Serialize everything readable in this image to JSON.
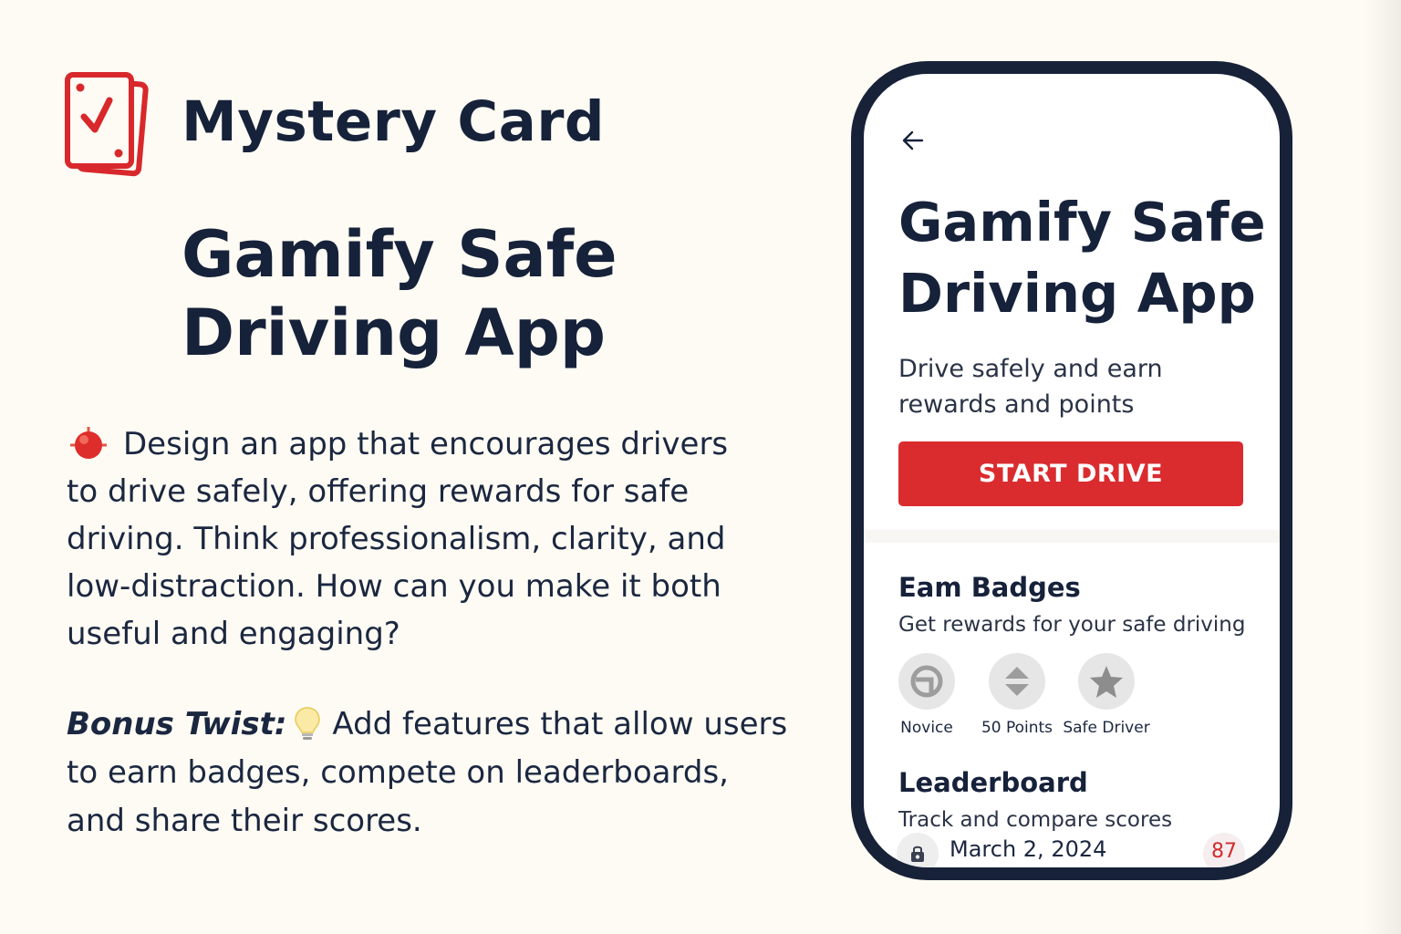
{
  "card": {
    "brand_title": "Mystery Card",
    "title": "Gamify Safe Driving App",
    "prompt": "Design an app that encourages drivers to drive safely, offering rewards for safe driving. Think professionalism, clarity, and low-distraction. How can you make it both useful and engaging?",
    "bonus_label": "Bonus Twist:",
    "bonus_text": "Add features that allow users to earn badges, compete on leaderboards, and share their scores.",
    "icons": [
      "card-check-icon",
      "target-icon",
      "lightbulb-icon"
    ]
  },
  "phone": {
    "title": "Gamify Safe Driving App",
    "subtitle": "Drive safely and earn rewards and points",
    "start_button": "START DRIVE",
    "badges_section": {
      "heading": "Eam Badges",
      "description": "Get rewards for your safe driving",
      "badges": [
        {
          "label": "Novice",
          "icon": "steering-wheel-icon"
        },
        {
          "label": "50 Points",
          "icon": "chevrons-icon"
        },
        {
          "label": "Safe Driver",
          "icon": "star-icon"
        }
      ]
    },
    "leaderboard": {
      "heading": "Leaderboard",
      "description": "Track and compare scores",
      "entries": [
        {
          "date": "March 2, 2024",
          "score": "87",
          "icon": "lock-icon"
        }
      ]
    }
  },
  "colors": {
    "background": "#fdfbf3",
    "text_dark": "#16213a",
    "accent_red": "#da2c2f",
    "phone_frame": "#172238"
  }
}
